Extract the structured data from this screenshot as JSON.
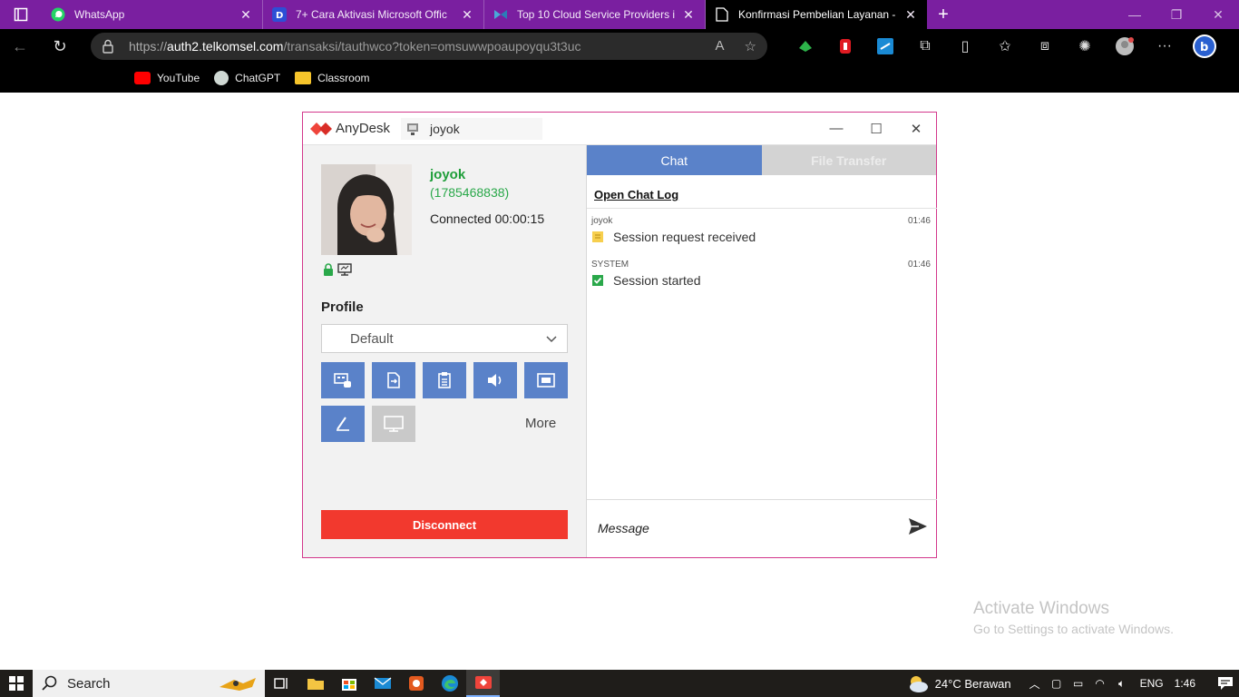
{
  "browser": {
    "tabs": [
      {
        "title": "WhatsApp",
        "favicon": "whatsapp-icon",
        "active": false
      },
      {
        "title": "7+ Cara Aktivasi Microsoft Offic",
        "favicon": "d-logo-icon",
        "active": false
      },
      {
        "title": "Top 10 Cloud Service Providers i",
        "favicon": "butterfly-icon",
        "active": false
      },
      {
        "title": "Konfirmasi Pembelian Layanan -",
        "favicon": "page-icon",
        "active": true
      }
    ],
    "address": {
      "prefix": "https://",
      "host": "auth2.telkomsel.com",
      "path": "/transaksi/tauthwco?token=omsuwwpoaupoyqu3t3uc"
    },
    "bookmarks": [
      {
        "label": "YouTube",
        "icon": "youtube-icon",
        "color": "#ff0000"
      },
      {
        "label": "ChatGPT",
        "icon": "chatgpt-icon",
        "color": "#cfd8d3"
      },
      {
        "label": "Classroom",
        "icon": "classroom-icon",
        "color": "#f7c52b"
      }
    ]
  },
  "anydesk": {
    "brand": "AnyDesk",
    "session_tab": "joyok",
    "peer": {
      "name": "joyok",
      "id": "(1785468838)",
      "status": "Connected 00:00:15"
    },
    "profile_label": "Profile",
    "profile_value": "Default",
    "more_label": "More",
    "disconnect_label": "Disconnect",
    "accent": "#5a82c9",
    "danger": "#f2392e",
    "chat": {
      "tabs": [
        "Chat",
        "File Transfer"
      ],
      "open_log": "Open Chat Log",
      "messages": [
        {
          "sender": "joyok",
          "time": "01:46",
          "text": "Session request received",
          "icon": "request-icon"
        },
        {
          "sender": "SYSTEM",
          "time": "01:46",
          "text": "Session started",
          "icon": "check-icon"
        }
      ],
      "input_placeholder": "Message"
    }
  },
  "watermark": {
    "line1": "Activate Windows",
    "line2": "Go to Settings to activate Windows."
  },
  "taskbar": {
    "search_label": "Search",
    "weather": "24°C  Berawan",
    "lang": "ENG",
    "time": "1:46"
  }
}
